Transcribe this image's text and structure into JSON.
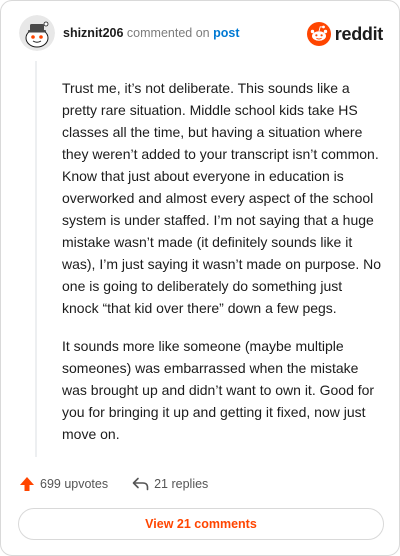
{
  "header": {
    "username": "shiznit206",
    "commented_text": "commented on",
    "post_link": "post",
    "logo_text": "reddit"
  },
  "comment": {
    "paragraphs": [
      "Trust me, it’s not deliberate. This sounds like a pretty rare situation. Middle school kids take HS classes all the time, but having a situation where they weren’t added to your transcript isn’t common. Know that just about everyone in education is overworked and almost every aspect of the school system is under staffed. I’m not saying that a huge mistake wasn’t made (it definitely sounds like it was), I’m just saying it wasn’t made on purpose. No one is going to deliberately do something just knock “that kid over there” down a few pegs.",
      "It sounds more like someone (maybe multiple someones) was embarrassed when the mistake was brought up and didn’t want to own it. Good for you for bringing it up and getting it fixed, now just move on."
    ]
  },
  "actions": {
    "upvotes": "699 upvotes",
    "replies": "21 replies"
  },
  "view_comments_label": "View 21 comments",
  "colors": {
    "brand": "#ff4500",
    "link": "#0079d3",
    "text": "#1c1c1c"
  },
  "icons": [
    "snoo-avatar-icon",
    "reddit-logo-icon",
    "upvote-arrow-icon",
    "reply-arrow-icon"
  ]
}
